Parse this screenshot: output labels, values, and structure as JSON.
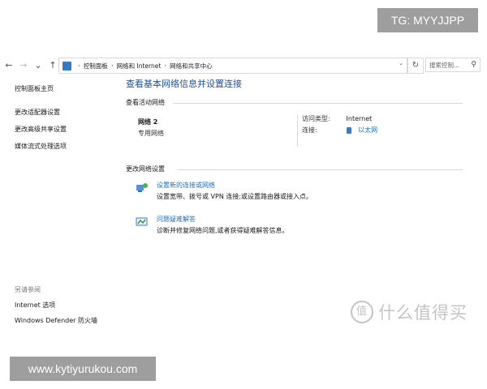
{
  "watermarks": {
    "tag": "TG: MYYJJPP",
    "url": "www.kytiyurukou.com",
    "brand_text": "什么值得买",
    "brand_logo": "值"
  },
  "addressbar": {
    "breadcrumbs": [
      "控制面板",
      "网络和 Internet",
      "网络和共享中心"
    ],
    "search_placeholder": "搜索控制...",
    "icons": {
      "back": "left-arrow-icon",
      "forward": "right-arrow-icon",
      "recent": "chevron-down-icon",
      "up": "up-arrow-icon",
      "refresh": "refresh-icon",
      "search": "search-icon"
    }
  },
  "sidebar": {
    "home": "控制面板主页",
    "items": [
      "更改适配器设置",
      "更改高级共享设置",
      "媒体流式处理选项"
    ],
    "see_also_header": "另请参阅",
    "see_also": [
      "Internet 选项",
      "Windows Defender 防火墙"
    ]
  },
  "main": {
    "title": "查看基本网络信息并设置连接",
    "active_header": "查看活动网络",
    "network": {
      "name": "网络 2",
      "type": "专用网络",
      "access_label": "访问类型:",
      "access_value": "Internet",
      "conn_label": "连接:",
      "conn_value": "以太网"
    },
    "change_header": "更改网络设置",
    "tasks": [
      {
        "link": "设置新的连接或网络",
        "desc": "设置宽带、拨号或 VPN 连接;或设置路由器或接入点。"
      },
      {
        "link": "问题疑难解答",
        "desc": "诊断并修复网络问题,或者获得疑难解答信息。"
      }
    ]
  },
  "colors": {
    "link_blue": "#1e6fc4",
    "title_blue": "#1e4f9e",
    "watermark_gray": "#9e9e9e"
  }
}
